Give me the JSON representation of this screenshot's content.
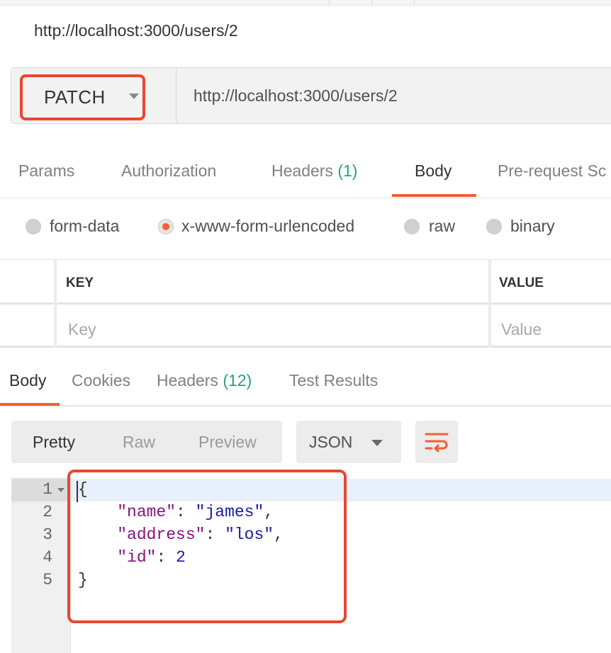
{
  "request": {
    "title": "http://localhost:3000/users/2",
    "method": "PATCH",
    "url": "http://localhost:3000/users/2"
  },
  "request_tabs": [
    {
      "label": "Params"
    },
    {
      "label": "Authorization"
    },
    {
      "label": "Headers",
      "count": "(1)"
    },
    {
      "label": "Body",
      "active": true
    },
    {
      "label": "Pre-request Sc"
    }
  ],
  "body_types": [
    {
      "label": "form-data",
      "checked": false
    },
    {
      "label": "x-www-form-urlencoded",
      "checked": true
    },
    {
      "label": "raw",
      "checked": false
    },
    {
      "label": "binary",
      "checked": false
    }
  ],
  "kv_table": {
    "key_header": "KEY",
    "value_header": "VALUE",
    "key_placeholder": "Key",
    "value_placeholder": "Value"
  },
  "response_tabs": [
    {
      "label": "Body",
      "active": true
    },
    {
      "label": "Cookies"
    },
    {
      "label": "Headers",
      "count": "(12)"
    },
    {
      "label": "Test Results"
    }
  ],
  "response_toolbar": {
    "formats": [
      "Pretty",
      "Raw",
      "Preview"
    ],
    "active_format": "Pretty",
    "language": "JSON",
    "wrap_icon": "wrap-lines-icon"
  },
  "response_body": {
    "line_numbers": [
      "1",
      "2",
      "3",
      "4",
      "5"
    ],
    "lines": [
      {
        "open": "{"
      },
      {
        "key": "\"name\"",
        "value": "\"james\"",
        "value_type": "string",
        "trailing": ","
      },
      {
        "key": "\"address\"",
        "value": "\"los\"",
        "value_type": "string",
        "trailing": ","
      },
      {
        "key": "\"id\"",
        "value": "2",
        "value_type": "number",
        "trailing": ""
      },
      {
        "close": "}"
      }
    ]
  },
  "colors": {
    "accent": "#f06035",
    "highlight_box": "#e8472e",
    "count_green": "#26a37c",
    "json_key": "#881280",
    "json_value": "#1a1aa6"
  }
}
